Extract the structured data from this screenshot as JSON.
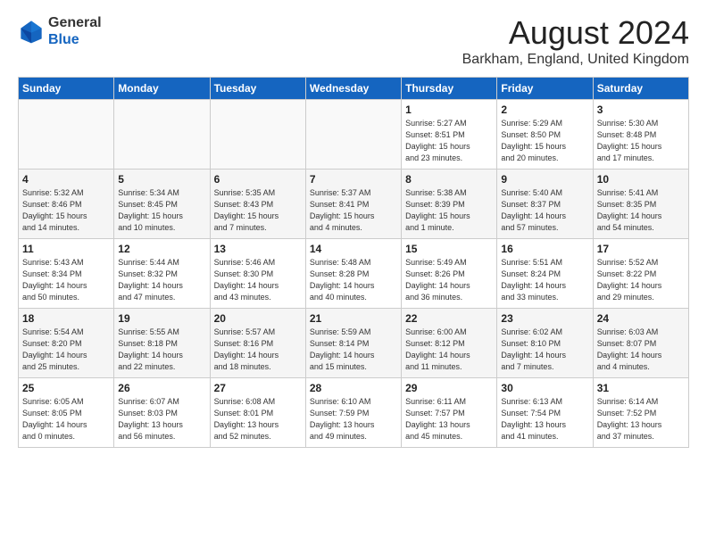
{
  "header": {
    "logo_general": "General",
    "logo_blue": "Blue",
    "month_title": "August 2024",
    "location": "Barkham, England, United Kingdom"
  },
  "weekdays": [
    "Sunday",
    "Monday",
    "Tuesday",
    "Wednesday",
    "Thursday",
    "Friday",
    "Saturday"
  ],
  "weeks": [
    [
      {
        "day": "",
        "detail": ""
      },
      {
        "day": "",
        "detail": ""
      },
      {
        "day": "",
        "detail": ""
      },
      {
        "day": "",
        "detail": ""
      },
      {
        "day": "1",
        "detail": "Sunrise: 5:27 AM\nSunset: 8:51 PM\nDaylight: 15 hours\nand 23 minutes."
      },
      {
        "day": "2",
        "detail": "Sunrise: 5:29 AM\nSunset: 8:50 PM\nDaylight: 15 hours\nand 20 minutes."
      },
      {
        "day": "3",
        "detail": "Sunrise: 5:30 AM\nSunset: 8:48 PM\nDaylight: 15 hours\nand 17 minutes."
      }
    ],
    [
      {
        "day": "4",
        "detail": "Sunrise: 5:32 AM\nSunset: 8:46 PM\nDaylight: 15 hours\nand 14 minutes."
      },
      {
        "day": "5",
        "detail": "Sunrise: 5:34 AM\nSunset: 8:45 PM\nDaylight: 15 hours\nand 10 minutes."
      },
      {
        "day": "6",
        "detail": "Sunrise: 5:35 AM\nSunset: 8:43 PM\nDaylight: 15 hours\nand 7 minutes."
      },
      {
        "day": "7",
        "detail": "Sunrise: 5:37 AM\nSunset: 8:41 PM\nDaylight: 15 hours\nand 4 minutes."
      },
      {
        "day": "8",
        "detail": "Sunrise: 5:38 AM\nSunset: 8:39 PM\nDaylight: 15 hours\nand 1 minute."
      },
      {
        "day": "9",
        "detail": "Sunrise: 5:40 AM\nSunset: 8:37 PM\nDaylight: 14 hours\nand 57 minutes."
      },
      {
        "day": "10",
        "detail": "Sunrise: 5:41 AM\nSunset: 8:35 PM\nDaylight: 14 hours\nand 54 minutes."
      }
    ],
    [
      {
        "day": "11",
        "detail": "Sunrise: 5:43 AM\nSunset: 8:34 PM\nDaylight: 14 hours\nand 50 minutes."
      },
      {
        "day": "12",
        "detail": "Sunrise: 5:44 AM\nSunset: 8:32 PM\nDaylight: 14 hours\nand 47 minutes."
      },
      {
        "day": "13",
        "detail": "Sunrise: 5:46 AM\nSunset: 8:30 PM\nDaylight: 14 hours\nand 43 minutes."
      },
      {
        "day": "14",
        "detail": "Sunrise: 5:48 AM\nSunset: 8:28 PM\nDaylight: 14 hours\nand 40 minutes."
      },
      {
        "day": "15",
        "detail": "Sunrise: 5:49 AM\nSunset: 8:26 PM\nDaylight: 14 hours\nand 36 minutes."
      },
      {
        "day": "16",
        "detail": "Sunrise: 5:51 AM\nSunset: 8:24 PM\nDaylight: 14 hours\nand 33 minutes."
      },
      {
        "day": "17",
        "detail": "Sunrise: 5:52 AM\nSunset: 8:22 PM\nDaylight: 14 hours\nand 29 minutes."
      }
    ],
    [
      {
        "day": "18",
        "detail": "Sunrise: 5:54 AM\nSunset: 8:20 PM\nDaylight: 14 hours\nand 25 minutes."
      },
      {
        "day": "19",
        "detail": "Sunrise: 5:55 AM\nSunset: 8:18 PM\nDaylight: 14 hours\nand 22 minutes."
      },
      {
        "day": "20",
        "detail": "Sunrise: 5:57 AM\nSunset: 8:16 PM\nDaylight: 14 hours\nand 18 minutes."
      },
      {
        "day": "21",
        "detail": "Sunrise: 5:59 AM\nSunset: 8:14 PM\nDaylight: 14 hours\nand 15 minutes."
      },
      {
        "day": "22",
        "detail": "Sunrise: 6:00 AM\nSunset: 8:12 PM\nDaylight: 14 hours\nand 11 minutes."
      },
      {
        "day": "23",
        "detail": "Sunrise: 6:02 AM\nSunset: 8:10 PM\nDaylight: 14 hours\nand 7 minutes."
      },
      {
        "day": "24",
        "detail": "Sunrise: 6:03 AM\nSunset: 8:07 PM\nDaylight: 14 hours\nand 4 minutes."
      }
    ],
    [
      {
        "day": "25",
        "detail": "Sunrise: 6:05 AM\nSunset: 8:05 PM\nDaylight: 14 hours\nand 0 minutes."
      },
      {
        "day": "26",
        "detail": "Sunrise: 6:07 AM\nSunset: 8:03 PM\nDaylight: 13 hours\nand 56 minutes."
      },
      {
        "day": "27",
        "detail": "Sunrise: 6:08 AM\nSunset: 8:01 PM\nDaylight: 13 hours\nand 52 minutes."
      },
      {
        "day": "28",
        "detail": "Sunrise: 6:10 AM\nSunset: 7:59 PM\nDaylight: 13 hours\nand 49 minutes."
      },
      {
        "day": "29",
        "detail": "Sunrise: 6:11 AM\nSunset: 7:57 PM\nDaylight: 13 hours\nand 45 minutes."
      },
      {
        "day": "30",
        "detail": "Sunrise: 6:13 AM\nSunset: 7:54 PM\nDaylight: 13 hours\nand 41 minutes."
      },
      {
        "day": "31",
        "detail": "Sunrise: 6:14 AM\nSunset: 7:52 PM\nDaylight: 13 hours\nand 37 minutes."
      }
    ]
  ]
}
